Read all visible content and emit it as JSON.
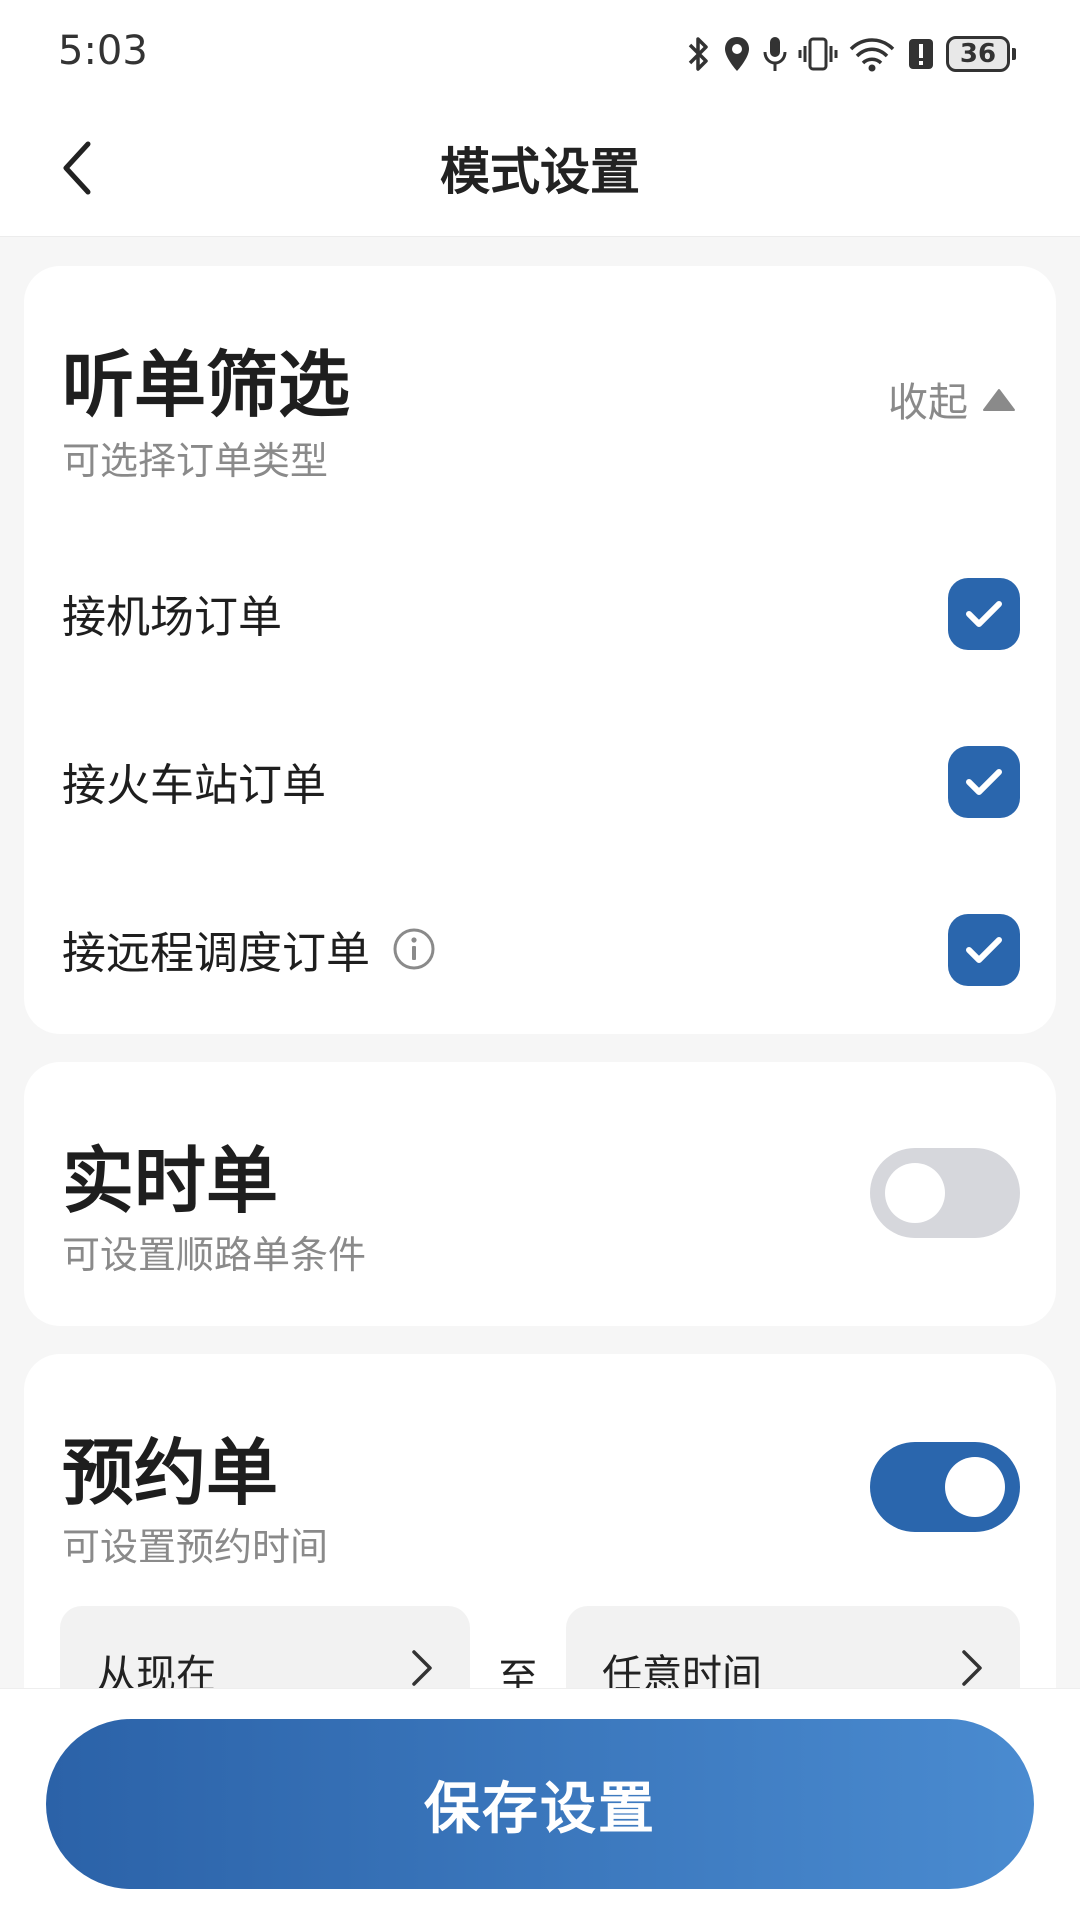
{
  "status_bar": {
    "time": "5:03",
    "battery": "36",
    "icons": [
      "bluetooth-icon",
      "location-icon",
      "mic-icon",
      "vibrate-icon",
      "wifi-icon",
      "alert-icon",
      "battery-icon"
    ]
  },
  "header": {
    "title": "模式设置",
    "back_icon": "chevron-left-icon"
  },
  "filter_card": {
    "title": "听单筛选",
    "subtitle": "可选择订单类型",
    "collapse_label": "收起",
    "options": [
      {
        "label": "接机场订单",
        "checked": true
      },
      {
        "label": "接火车站订单",
        "checked": true
      },
      {
        "label": "接远程调度订单",
        "checked": true,
        "info": true
      }
    ]
  },
  "realtime_card": {
    "title": "实时单",
    "subtitle": "可设置顺路单条件",
    "enabled": false
  },
  "reserve_card": {
    "title": "预约单",
    "subtitle": "可设置预约时间",
    "enabled": true,
    "from_label": "从现在",
    "separator": "至",
    "to_label": "任意时间"
  },
  "footer": {
    "save_label": "保存设置"
  },
  "colors": {
    "accent": "#2a66ad",
    "toggle_off": "#d6d7dc",
    "background": "#f6f6f6"
  }
}
